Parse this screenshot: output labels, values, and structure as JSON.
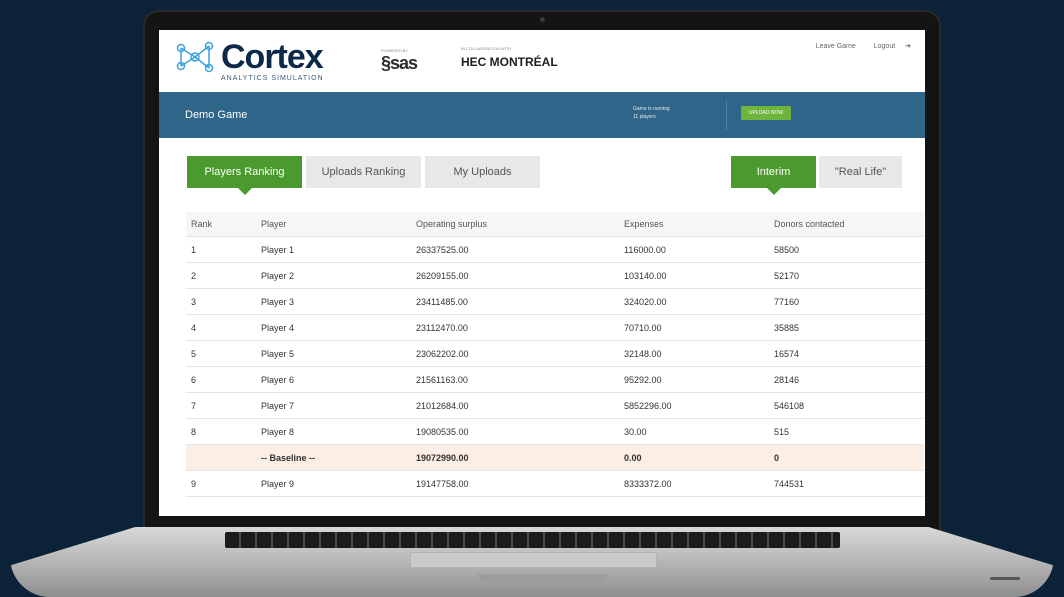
{
  "header": {
    "logo_word": "Cortex",
    "logo_subtitle": "ANALYTICS SIMULATION",
    "partner_sas_label": "POWERED BY",
    "partner_sas": "sas",
    "partner_hec_label": "IN COLLABORATION WITH",
    "partner_hec": "HEC MONTRÉAL",
    "links": [
      "Leave Game",
      "Logout"
    ]
  },
  "bar": {
    "title": "Demo Game",
    "status_line1": "Game is running",
    "status_line2": "11 players",
    "button_label": "UPLOAD NOW"
  },
  "tabs": {
    "left": [
      {
        "label": "Players Ranking",
        "active": true
      },
      {
        "label": "Uploads Ranking",
        "active": false
      },
      {
        "label": "My Uploads",
        "active": false
      }
    ],
    "right": [
      {
        "label": "Interim",
        "active": true
      },
      {
        "label": "\"Real Life\"",
        "active": false
      }
    ]
  },
  "table": {
    "columns": [
      "Rank",
      "Player",
      "Operating surplus",
      "Expenses",
      "Donors contacted"
    ],
    "rows": [
      [
        "1",
        "Player 1",
        "26337525.00",
        "116000.00",
        "58500"
      ],
      [
        "2",
        "Player 2",
        "26209155.00",
        "103140.00",
        "52170"
      ],
      [
        "3",
        "Player 3",
        "23411485.00",
        "324020.00",
        "77160"
      ],
      [
        "4",
        "Player 4",
        "23112470.00",
        "70710.00",
        "35885"
      ],
      [
        "5",
        "Player 5",
        "23062202.00",
        "32148.00",
        "16574"
      ],
      [
        "6",
        "Player 6",
        "21561163.00",
        "95292.00",
        "28146"
      ],
      [
        "7",
        "Player 7",
        "21012684.00",
        "5852296.00",
        "546108"
      ],
      [
        "8",
        "Player 8",
        "19080535.00",
        "30.00",
        "515"
      ],
      [
        "",
        "-- Baseline --",
        "19072990.00",
        "0.00",
        "0"
      ],
      [
        "9",
        "Player 9",
        "19147758.00",
        "8333372.00",
        "744531"
      ]
    ],
    "baseline_row_index": 8
  },
  "colors": {
    "background": "#0c2238",
    "nav_bar": "#2f6589",
    "active_tab": "#4a9a2e",
    "baseline_highlight": "#fbeee5"
  }
}
